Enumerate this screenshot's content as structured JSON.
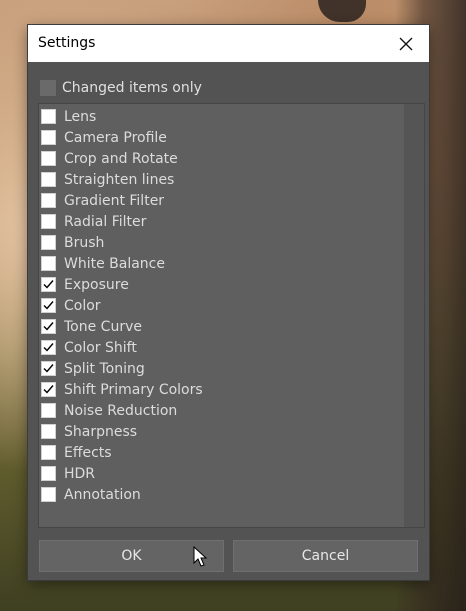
{
  "dialog": {
    "title": "Settings",
    "changed_only_label": "Changed items only",
    "changed_only_checked": false,
    "ok_label": "OK",
    "cancel_label": "Cancel"
  },
  "items": [
    {
      "label": "Lens",
      "checked": false
    },
    {
      "label": "Camera Profile",
      "checked": false
    },
    {
      "label": "Crop and Rotate",
      "checked": false
    },
    {
      "label": "Straighten lines",
      "checked": false
    },
    {
      "label": "Gradient Filter",
      "checked": false
    },
    {
      "label": "Radial Filter",
      "checked": false
    },
    {
      "label": "Brush",
      "checked": false
    },
    {
      "label": "White Balance",
      "checked": false
    },
    {
      "label": "Exposure",
      "checked": true
    },
    {
      "label": "Color",
      "checked": true
    },
    {
      "label": "Tone Curve",
      "checked": true
    },
    {
      "label": "Color Shift",
      "checked": true
    },
    {
      "label": "Split Toning",
      "checked": true
    },
    {
      "label": "Shift Primary Colors",
      "checked": true
    },
    {
      "label": "Noise Reduction",
      "checked": false
    },
    {
      "label": "Sharpness",
      "checked": false
    },
    {
      "label": "Effects",
      "checked": false
    },
    {
      "label": "HDR",
      "checked": false
    },
    {
      "label": "Annotation",
      "checked": false
    }
  ],
  "colors": {
    "dialog_bg": "#535353",
    "list_bg": "#5f5f5f",
    "text": "#dcdcdc",
    "titlebar": "#ffffff"
  },
  "icons": [
    "close-icon",
    "checkmark-icon",
    "mouse-cursor-icon"
  ]
}
